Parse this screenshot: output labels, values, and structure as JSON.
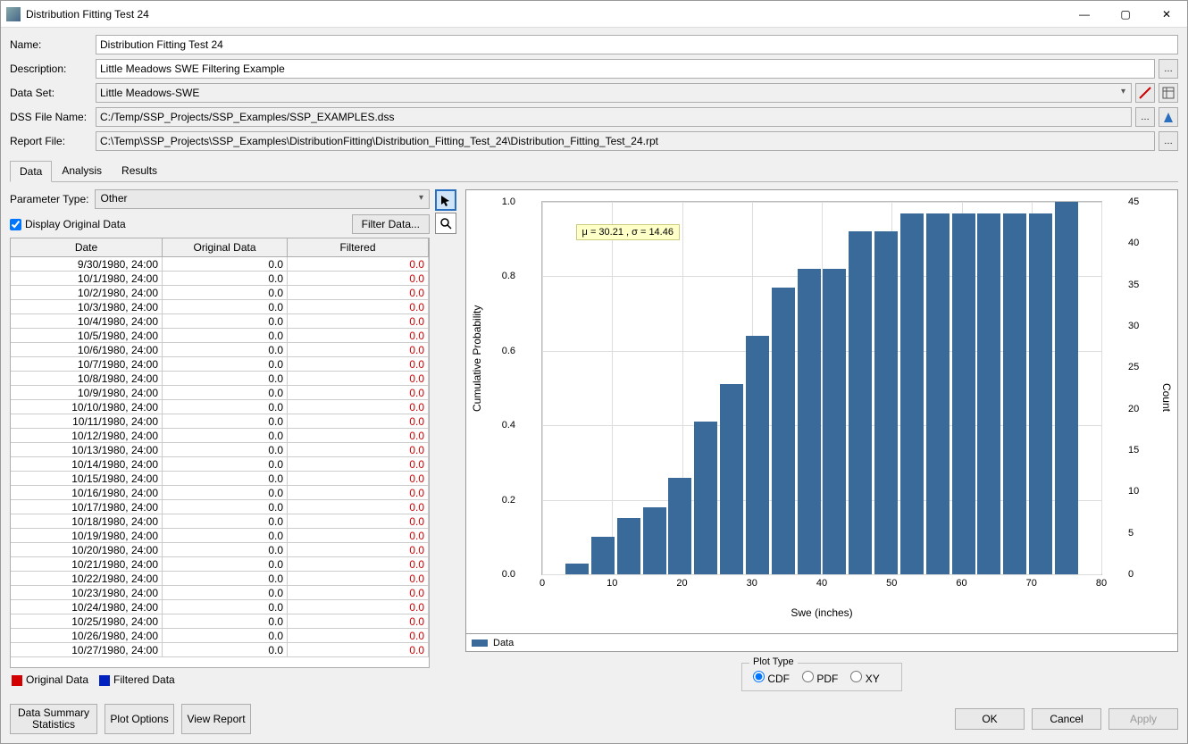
{
  "window": {
    "title": "Distribution Fitting Test 24"
  },
  "form": {
    "name_label": "Name:",
    "name_value": "Distribution Fitting Test 24",
    "desc_label": "Description:",
    "desc_value": "Little Meadows SWE Filtering Example",
    "dataset_label": "Data Set:",
    "dataset_value": "Little Meadows-SWE",
    "dssfile_label": "DSS File Name:",
    "dssfile_value": "C:/Temp/SSP_Projects/SSP_Examples/SSP_EXAMPLES.dss",
    "report_label": "Report File:",
    "report_value": "C:\\Temp\\SSP_Projects\\SSP_Examples\\DistributionFitting\\Distribution_Fitting_Test_24\\Distribution_Fitting_Test_24.rpt"
  },
  "tabs": {
    "data": "Data",
    "analysis": "Analysis",
    "results": "Results"
  },
  "left": {
    "param_label": "Parameter Type:",
    "param_value": "Other",
    "display_original": "Display Original Data",
    "filter_btn": "Filter Data...",
    "cols": {
      "date": "Date",
      "orig": "Original Data",
      "filt": "Filtered"
    },
    "rows": [
      {
        "d": "9/30/1980, 24:00",
        "o": "0.0",
        "f": "0.0"
      },
      {
        "d": "10/1/1980, 24:00",
        "o": "0.0",
        "f": "0.0"
      },
      {
        "d": "10/2/1980, 24:00",
        "o": "0.0",
        "f": "0.0"
      },
      {
        "d": "10/3/1980, 24:00",
        "o": "0.0",
        "f": "0.0"
      },
      {
        "d": "10/4/1980, 24:00",
        "o": "0.0",
        "f": "0.0"
      },
      {
        "d": "10/5/1980, 24:00",
        "o": "0.0",
        "f": "0.0"
      },
      {
        "d": "10/6/1980, 24:00",
        "o": "0.0",
        "f": "0.0"
      },
      {
        "d": "10/7/1980, 24:00",
        "o": "0.0",
        "f": "0.0"
      },
      {
        "d": "10/8/1980, 24:00",
        "o": "0.0",
        "f": "0.0"
      },
      {
        "d": "10/9/1980, 24:00",
        "o": "0.0",
        "f": "0.0"
      },
      {
        "d": "10/10/1980, 24:00",
        "o": "0.0",
        "f": "0.0"
      },
      {
        "d": "10/11/1980, 24:00",
        "o": "0.0",
        "f": "0.0"
      },
      {
        "d": "10/12/1980, 24:00",
        "o": "0.0",
        "f": "0.0"
      },
      {
        "d": "10/13/1980, 24:00",
        "o": "0.0",
        "f": "0.0"
      },
      {
        "d": "10/14/1980, 24:00",
        "o": "0.0",
        "f": "0.0"
      },
      {
        "d": "10/15/1980, 24:00",
        "o": "0.0",
        "f": "0.0"
      },
      {
        "d": "10/16/1980, 24:00",
        "o": "0.0",
        "f": "0.0"
      },
      {
        "d": "10/17/1980, 24:00",
        "o": "0.0",
        "f": "0.0"
      },
      {
        "d": "10/18/1980, 24:00",
        "o": "0.0",
        "f": "0.0"
      },
      {
        "d": "10/19/1980, 24:00",
        "o": "0.0",
        "f": "0.0"
      },
      {
        "d": "10/20/1980, 24:00",
        "o": "0.0",
        "f": "0.0"
      },
      {
        "d": "10/21/1980, 24:00",
        "o": "0.0",
        "f": "0.0"
      },
      {
        "d": "10/22/1980, 24:00",
        "o": "0.0",
        "f": "0.0"
      },
      {
        "d": "10/23/1980, 24:00",
        "o": "0.0",
        "f": "0.0"
      },
      {
        "d": "10/24/1980, 24:00",
        "o": "0.0",
        "f": "0.0"
      },
      {
        "d": "10/25/1980, 24:00",
        "o": "0.0",
        "f": "0.0"
      },
      {
        "d": "10/26/1980, 24:00",
        "o": "0.0",
        "f": "0.0"
      },
      {
        "d": "10/27/1980, 24:00",
        "o": "0.0",
        "f": "0.0"
      }
    ],
    "legend_original": "Original Data",
    "legend_filtered": "Filtered Data",
    "color_original": "#d40000",
    "color_filtered": "#0020c0"
  },
  "chart_data": {
    "type": "bar",
    "annotation": "μ = 30.21 , σ = 14.46",
    "xlabel": "Swe (inches)",
    "ylabel": "Cumulative Probability",
    "y2label": "Count",
    "xlim": [
      0,
      80
    ],
    "ylim": [
      0.0,
      1.0
    ],
    "y2lim": [
      0,
      45
    ],
    "xticks": [
      0,
      10,
      20,
      30,
      40,
      50,
      60,
      70,
      80
    ],
    "yticks": [
      0.0,
      0.2,
      0.4,
      0.6,
      0.8,
      1.0
    ],
    "y2ticks": [
      0,
      5,
      10,
      15,
      20,
      25,
      30,
      35,
      40,
      45
    ],
    "bin_centers": [
      5,
      10,
      15,
      20,
      25,
      30,
      35,
      40,
      45,
      50,
      55,
      60,
      65,
      70,
      75
    ],
    "values": [
      0.03,
      0.1,
      0.15,
      0.18,
      0.26,
      0.41,
      0.51,
      0.64,
      0.77,
      0.82,
      0.82,
      0.92,
      0.92,
      0.97,
      0.97,
      0.97,
      0.97,
      0.97,
      0.97,
      1.0
    ],
    "legend": "Data",
    "bar_color": "#3a6a99"
  },
  "plot_type": {
    "label": "Plot Type",
    "cdf": "CDF",
    "pdf": "PDF",
    "xy": "XY",
    "selected": "CDF"
  },
  "footer": {
    "stats": "Data Summary Statistics",
    "plot_opts": "Plot Options",
    "view_report": "View Report",
    "ok": "OK",
    "cancel": "Cancel",
    "apply": "Apply"
  }
}
